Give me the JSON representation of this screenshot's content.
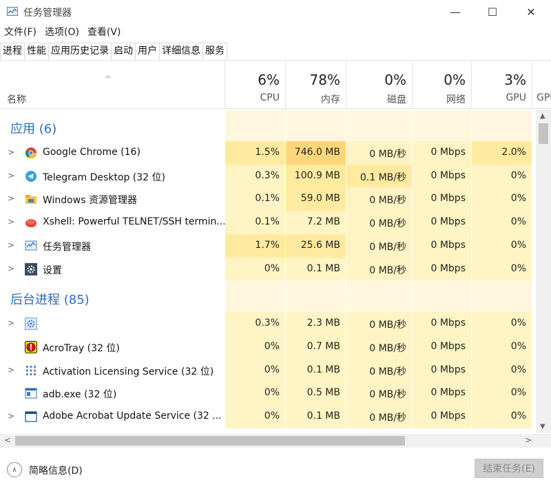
{
  "window": {
    "title": "任务管理器",
    "controls": {
      "minimize": "—",
      "maximize": "☐",
      "close": "✕"
    }
  },
  "menu": [
    "文件(F)",
    "选项(O)",
    "查看(V)"
  ],
  "tabs": [
    "进程",
    "性能",
    "应用历史记录",
    "启动",
    "用户",
    "详细信息",
    "服务"
  ],
  "active_tab": "进程",
  "header": {
    "name_label": "名称",
    "columns": [
      {
        "pct": "6%",
        "label": "CPU"
      },
      {
        "pct": "78%",
        "label": "内存"
      },
      {
        "pct": "0%",
        "label": "磁盘"
      },
      {
        "pct": "0%",
        "label": "网络"
      },
      {
        "pct": "3%",
        "label": "GPU"
      },
      {
        "pct": "",
        "label": "GPU"
      }
    ]
  },
  "groups": [
    {
      "title": "应用 (6)",
      "rows": [
        {
          "name": "Google Chrome (16)",
          "icon": "chrome-icon",
          "expandable": true,
          "cpu": "1.5%",
          "mem": "746.0 MB",
          "disk": "0 MB/秒",
          "net": "0 Mbps",
          "gpu": "2.0%"
        },
        {
          "name": "Telegram Desktop (32 位)",
          "icon": "telegram-icon",
          "expandable": true,
          "cpu": "0.3%",
          "mem": "100.9 MB",
          "disk": "0.1 MB/秒",
          "net": "0 Mbps",
          "gpu": "0%"
        },
        {
          "name": "Windows 资源管理器",
          "icon": "explorer-icon",
          "expandable": true,
          "cpu": "0.1%",
          "mem": "59.0 MB",
          "disk": "0 MB/秒",
          "net": "0 Mbps",
          "gpu": "0%"
        },
        {
          "name": "Xshell: Powerful TELNET/SSH termin...",
          "icon": "xshell-icon",
          "expandable": true,
          "cpu": "0.1%",
          "mem": "7.2 MB",
          "disk": "0 MB/秒",
          "net": "0 Mbps",
          "gpu": "0%"
        },
        {
          "name": "任务管理器",
          "icon": "task-manager-icon",
          "expandable": true,
          "cpu": "1.7%",
          "mem": "25.6 MB",
          "disk": "0 MB/秒",
          "net": "0 Mbps",
          "gpu": "0%"
        },
        {
          "name": "设置",
          "icon": "settings-gear-icon",
          "expandable": true,
          "cpu": "0%",
          "mem": "0.1 MB",
          "disk": "0 MB/秒",
          "net": "0 Mbps",
          "gpu": "0%"
        }
      ]
    },
    {
      "title": "后台进程 (85)",
      "rows": [
        {
          "name": "",
          "icon": "gear-process-icon",
          "expandable": true,
          "cpu": "0.3%",
          "mem": "2.3 MB",
          "disk": "0 MB/秒",
          "net": "0 Mbps",
          "gpu": "0%"
        },
        {
          "name": "AcroTray (32 位)",
          "icon": "acrotray-icon",
          "expandable": false,
          "cpu": "0%",
          "mem": "0.7 MB",
          "disk": "0 MB/秒",
          "net": "0 Mbps",
          "gpu": "0%"
        },
        {
          "name": "Activation Licensing Service (32 位)",
          "icon": "service-icon",
          "expandable": true,
          "cpu": "0%",
          "mem": "0.1 MB",
          "disk": "0 MB/秒",
          "net": "0 Mbps",
          "gpu": "0%"
        },
        {
          "name": "adb.exe (32 位)",
          "icon": "exe-icon",
          "expandable": false,
          "cpu": "0%",
          "mem": "0.5 MB",
          "disk": "0 MB/秒",
          "net": "0 Mbps",
          "gpu": "0%"
        },
        {
          "name": "Adobe Acrobat Update Service (32 ...",
          "icon": "window-icon",
          "expandable": true,
          "cpu": "0%",
          "mem": "0.1 MB",
          "disk": "0 MB/秒",
          "net": "0 Mbps",
          "gpu": "0%"
        }
      ]
    }
  ],
  "footer": {
    "fewer_details": "简略信息(D)",
    "end_task": "结束任务(E)"
  },
  "colors": {
    "heat_light": "#fff4c4",
    "heat_mid": "#ffeaa0",
    "heat_strong": "#ffd67a",
    "group_blank": "#fff8de",
    "group_title": "#2a6bbd"
  }
}
